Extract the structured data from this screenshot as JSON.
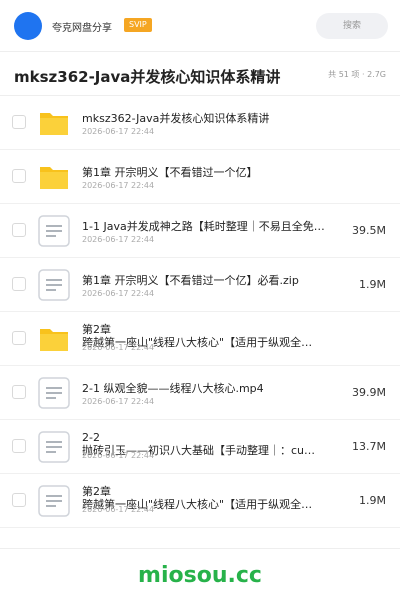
{
  "header": {
    "username": "夸克网盘分享",
    "badge": "SVIP",
    "search_placeholder": "搜索"
  },
  "share": {
    "title": "mksz362-Java并发核心知识体系精讲",
    "meta": "共 51 项 · 2.7G"
  },
  "files": [
    {
      "type": "folder-icon",
      "name": "mksz362-Java并发核心知识体系精讲",
      "date": "2026-06-17 22:44",
      "size": ""
    },
    {
      "type": "folder-icon",
      "name": "第1章 开宗明义【不看错过一个亿】",
      "date": "2026-06-17 22:44",
      "size": ""
    },
    {
      "type": "file-icon",
      "name": "1-1 Java并发成神之路【耗时整理｜不易且全免…",
      "date": "2026-06-17 22:44",
      "size": "39.5M"
    },
    {
      "type": "file-icon",
      "name": "第1章 开宗明义【不看错过一个亿】必看.zip",
      "date": "2026-06-17 22:44",
      "size": "1.9M"
    },
    {
      "type": "folder-icon",
      "name_line1": "第2章",
      "name_line2": "跨越第一座山\"线程八大核心\"【适用于纵观全…",
      "date": "2026-06-17 22:44",
      "size": ""
    },
    {
      "type": "file-icon",
      "name": "2-1 纵观全貌——线程八大核心.mp4",
      "date": "2026-06-17 22:44",
      "size": "39.9M"
    },
    {
      "type": "file-icon",
      "name_line1": "2-2",
      "name_line2": "抛砖引玉——初识八大基础【手动整理｜：cu…",
      "date": "2026-06-17 22:44",
      "size": "13.7M"
    },
    {
      "type": "file-icon",
      "name_line1": "第2章",
      "name_line2": "跨越第一座山\"线程八大核心\"【适用于纵观全…",
      "date": "2026-06-17 22:44",
      "size": "1.9M"
    }
  ],
  "footer": {
    "brand": "miosou.cc"
  },
  "colors": {
    "accent": "#1f74f0",
    "svip": "#f5a623",
    "folder": "#f8c21c",
    "brand": "#27b24a"
  }
}
